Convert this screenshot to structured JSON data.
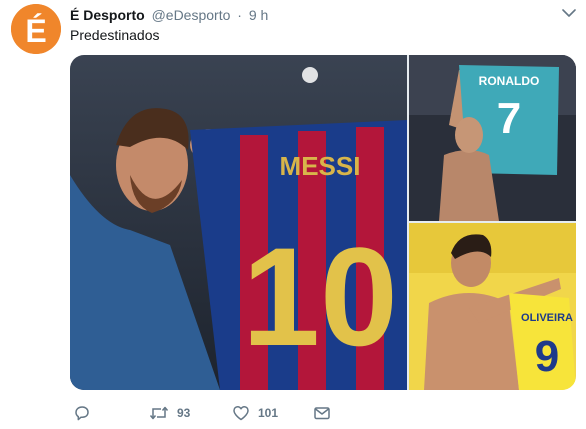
{
  "tweet": {
    "author_name": "É Desporto",
    "author_handle": "@eDesporto",
    "separator": "·",
    "time": "9 h",
    "text": "Predestinados",
    "avatar_glyph": "É",
    "avatar_color": "#f0862b"
  },
  "photos": {
    "main": {
      "shirt_name": "MESSI",
      "shirt_number": "10"
    },
    "top_right": {
      "shirt_name": "RONALDO",
      "shirt_number": "7"
    },
    "bottom_right": {
      "shirt_name": "OLIVEIRA",
      "shirt_number": "9"
    }
  },
  "actions": {
    "reply_icon": "reply-icon",
    "retweet_icon": "retweet-icon",
    "retweet_count": "93",
    "like_icon": "heart-icon",
    "like_count": "101",
    "message_icon": "envelope-icon",
    "icon_color": "#657786"
  }
}
